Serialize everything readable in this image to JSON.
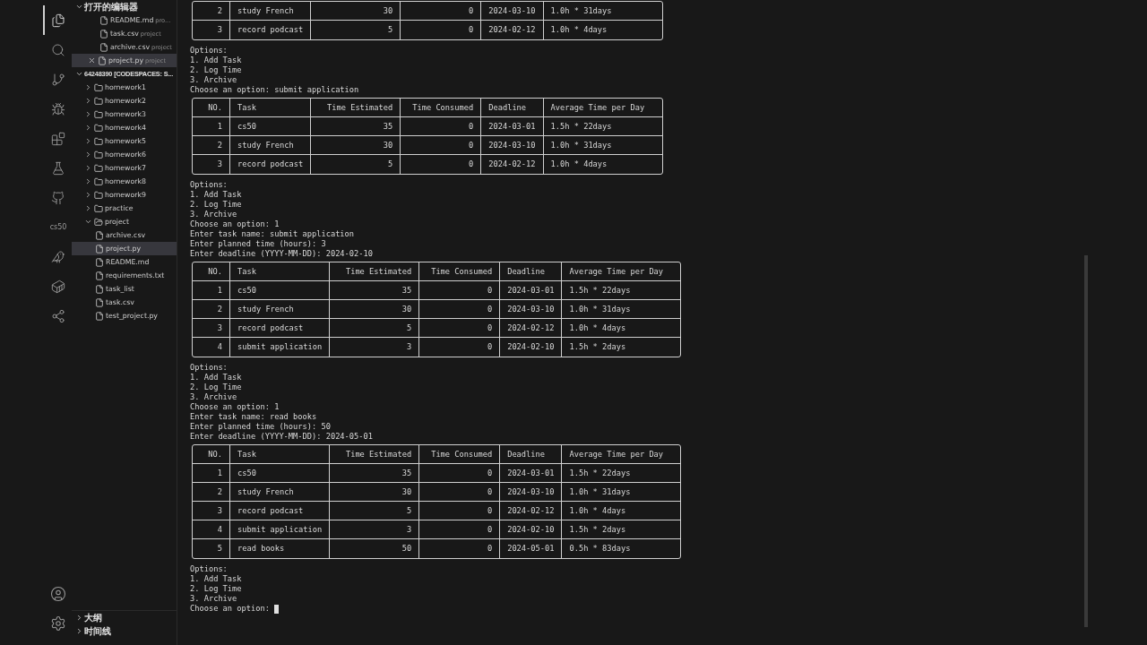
{
  "activity_bar": {
    "items": [
      {
        "kind": "icon",
        "selected": true
      },
      {
        "kind": "icon",
        "selected": false
      },
      {
        "kind": "icon",
        "selected": false
      },
      {
        "kind": "icon",
        "selected": false
      },
      {
        "kind": "icon",
        "selected": false
      },
      {
        "kind": "icon",
        "selected": false
      },
      {
        "kind": "icon",
        "selected": false
      },
      {
        "kind": "text",
        "label": "cs50",
        "selected": false
      },
      {
        "kind": "icon",
        "selected": false
      },
      {
        "kind": "icon",
        "selected": false
      },
      {
        "kind": "icon",
        "selected": false
      }
    ]
  },
  "open_editors": {
    "title": "打开的编辑器",
    "expanded": true,
    "items": [
      {
        "name": "README.md",
        "description": "pro...",
        "selected": false
      },
      {
        "name": "task.csv",
        "description": "project",
        "selected": false
      },
      {
        "name": "archive.csv",
        "description": "project",
        "selected": false
      },
      {
        "name": "project.py",
        "description": "project",
        "selected": true
      }
    ]
  },
  "workspace": {
    "title": "64248390 [CODESPACES: S...",
    "expanded": true,
    "children": [
      {
        "name": "homework1",
        "kind": "folder",
        "expanded": false,
        "selected": false
      },
      {
        "name": "homework2",
        "kind": "folder",
        "expanded": false,
        "selected": false
      },
      {
        "name": "homework3",
        "kind": "folder",
        "expanded": false,
        "selected": false
      },
      {
        "name": "homework4",
        "kind": "folder",
        "expanded": false,
        "selected": false
      },
      {
        "name": "homework5",
        "kind": "folder",
        "expanded": false,
        "selected": false
      },
      {
        "name": "homework6",
        "kind": "folder",
        "expanded": false,
        "selected": false
      },
      {
        "name": "homework7",
        "kind": "folder",
        "expanded": false,
        "selected": false
      },
      {
        "name": "homework8",
        "kind": "folder",
        "expanded": false,
        "selected": false
      },
      {
        "name": "homework9",
        "kind": "folder",
        "expanded": false,
        "selected": false
      },
      {
        "name": "practice",
        "kind": "folder",
        "expanded": false,
        "selected": false
      },
      {
        "name": "project",
        "kind": "folder",
        "expanded": true,
        "selected": false,
        "children": [
          {
            "name": "archive.csv",
            "kind": "file",
            "selected": false
          },
          {
            "name": "project.py",
            "kind": "file",
            "selected": true
          },
          {
            "name": "README.md",
            "kind": "file",
            "selected": false
          },
          {
            "name": "requirements.txt",
            "kind": "file",
            "selected": false
          },
          {
            "name": "task_list",
            "kind": "file",
            "selected": false
          },
          {
            "name": "task.csv",
            "kind": "file",
            "selected": false
          },
          {
            "name": "test_project.py",
            "kind": "file",
            "selected": false
          }
        ]
      }
    ]
  },
  "panels": [
    {
      "title": "大纲",
      "expanded": false
    },
    {
      "title": "时间线",
      "expanded": false
    }
  ],
  "terminal": {
    "blocks": [
      {
        "kind": "table",
        "rows": [
          [
            "2",
            "study French",
            "30",
            "0",
            "2024-03-10",
            "1.0h * 31days"
          ],
          [
            "3",
            "record podcast",
            "5",
            "0",
            "2024-02-12",
            "1.0h * 4days"
          ]
        ]
      },
      {
        "kind": "lines",
        "lines": [
          "Options:",
          "1. Add Task",
          "2. Log Time",
          "3. Archive",
          "Choose an option: submit application"
        ]
      },
      {
        "kind": "table",
        "columns": [
          "NO.",
          "Task",
          "Time Estimated",
          "Time Consumed",
          "Deadline",
          "Average Time per Day"
        ],
        "rows": [
          [
            "1",
            "cs50",
            "35",
            "0",
            "2024-03-01",
            "1.5h * 22days"
          ],
          [
            "2",
            "study French",
            "30",
            "0",
            "2024-03-10",
            "1.0h * 31days"
          ],
          [
            "3",
            "record podcast",
            "5",
            "0",
            "2024-02-12",
            "1.0h * 4days"
          ]
        ]
      },
      {
        "kind": "lines",
        "lines": [
          "Options:",
          "1. Add Task",
          "2. Log Time",
          "3. Archive",
          "Choose an option: 1",
          "Enter task name: submit application",
          "Enter planned time (hours): 3",
          "Enter deadline (YYYY-MM-DD): 2024-02-10"
        ]
      },
      {
        "kind": "table",
        "columns": [
          "NO.",
          "Task",
          "Time Estimated",
          "Time Consumed",
          "Deadline",
          "Average Time per Day"
        ],
        "rows": [
          [
            "1",
            "cs50",
            "35",
            "0",
            "2024-03-01",
            "1.5h * 22days"
          ],
          [
            "2",
            "study French",
            "30",
            "0",
            "2024-03-10",
            "1.0h * 31days"
          ],
          [
            "3",
            "record podcast",
            "5",
            "0",
            "2024-02-12",
            "1.0h * 4days"
          ],
          [
            "4",
            "submit application",
            "3",
            "0",
            "2024-02-10",
            "1.5h * 2days"
          ]
        ]
      },
      {
        "kind": "lines",
        "lines": [
          "Options:",
          "1. Add Task",
          "2. Log Time",
          "3. Archive",
          "Choose an option: 1",
          "Enter task name: read books",
          "Enter planned time (hours): 50",
          "Enter deadline (YYYY-MM-DD): 2024-05-01"
        ]
      },
      {
        "kind": "table",
        "columns": [
          "NO.",
          "Task",
          "Time Estimated",
          "Time Consumed",
          "Deadline",
          "Average Time per Day"
        ],
        "rows": [
          [
            "1",
            "cs50",
            "35",
            "0",
            "2024-03-01",
            "1.5h * 22days"
          ],
          [
            "2",
            "study French",
            "30",
            "0",
            "2024-03-10",
            "1.0h * 31days"
          ],
          [
            "3",
            "record podcast",
            "5",
            "0",
            "2024-02-12",
            "1.0h * 4days"
          ],
          [
            "4",
            "submit application",
            "3",
            "0",
            "2024-02-10",
            "1.5h * 2days"
          ],
          [
            "5",
            "read books",
            "50",
            "0",
            "2024-05-01",
            "0.5h * 83days"
          ]
        ]
      },
      {
        "kind": "lines",
        "cursor": true,
        "lines": [
          "Options:",
          "1. Add Task",
          "2. Log Time",
          "3. Archive",
          "Choose an option: "
        ]
      }
    ]
  }
}
